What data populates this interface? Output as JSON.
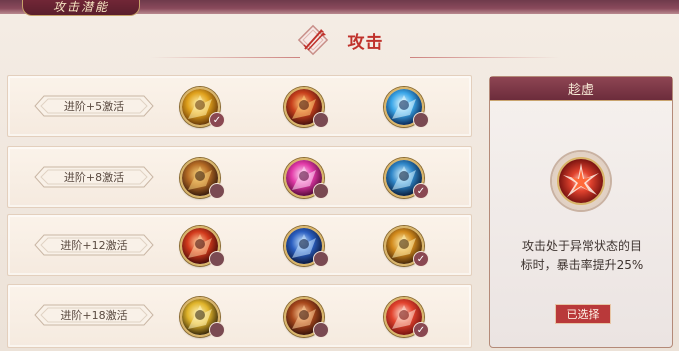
{
  "tab": {
    "label": "攻击潜能"
  },
  "header": {
    "title": "攻击",
    "icon": "arrows-emblem-icon"
  },
  "rows": [
    {
      "label": "进阶+5激活",
      "skills": [
        {
          "icon": "golden-slash-skill-icon",
          "state": "checked"
        },
        {
          "icon": "fire-warrior-skill-icon",
          "state": "locked"
        },
        {
          "icon": "ice-blade-skill-icon",
          "state": "locked"
        }
      ]
    },
    {
      "label": "进阶+8激活",
      "skills": [
        {
          "icon": "bronze-knight-skill-icon",
          "state": "locked"
        },
        {
          "icon": "pink-blade-skill-icon",
          "state": "locked"
        },
        {
          "icon": "blue-dancer-skill-icon",
          "state": "checked"
        }
      ]
    },
    {
      "label": "进阶+12激活",
      "skills": [
        {
          "icon": "flame-strike-skill-icon",
          "state": "locked"
        },
        {
          "icon": "blue-warrior-skill-icon",
          "state": "locked"
        },
        {
          "icon": "gold-warrior-skill-icon",
          "state": "checked"
        }
      ]
    },
    {
      "label": "进阶+18激活",
      "skills": [
        {
          "icon": "golden-shield-skill-icon",
          "state": "locked"
        },
        {
          "icon": "armored-warrior-skill-icon",
          "state": "locked"
        },
        {
          "icon": "red-burst-skill-icon",
          "state": "checked"
        }
      ]
    }
  ],
  "panel": {
    "title": "趁虚",
    "icon": "red-burst-skill-icon",
    "desc_line1": "攻击处于异常状态的目",
    "desc_line2": "标时，暴击率提升25%",
    "button_label": "已选择"
  },
  "colors": {
    "accent_red": "#c0312b",
    "panel_head": "#8e4553",
    "button": "#b9393a"
  }
}
